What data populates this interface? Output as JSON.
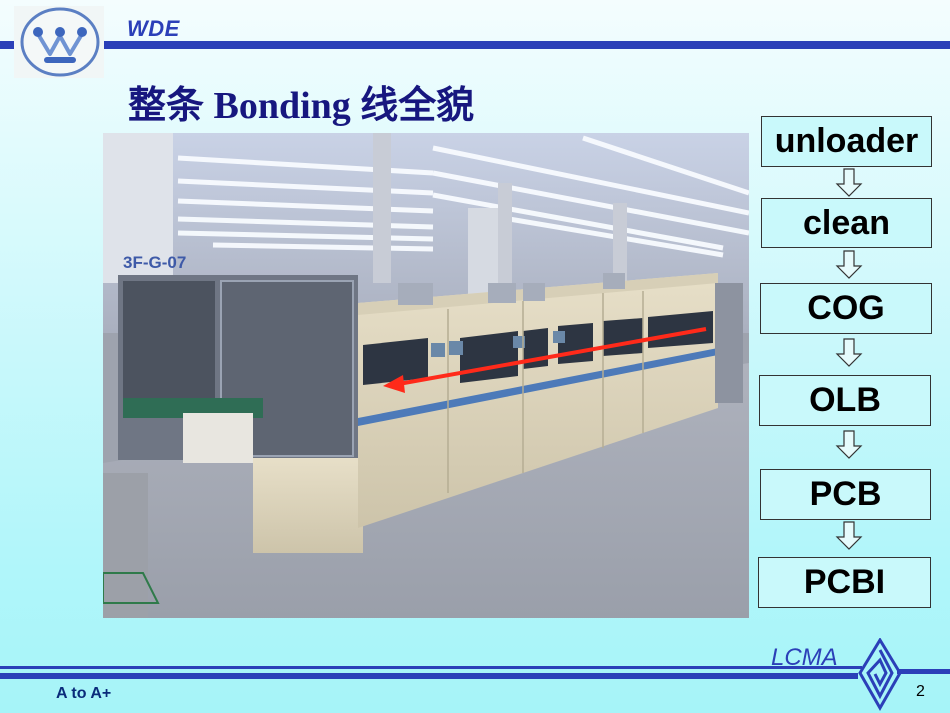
{
  "header": {
    "brand": "WDE",
    "logo": "wde-logo-icon"
  },
  "slide": {
    "title": "整条 Bonding 线全貌",
    "photo": {
      "description": "Full Bonding production line in cleanroom",
      "signage": "3F-G-07",
      "arrow_color": "#ff2a1a",
      "arrow_direction": "right-to-left"
    },
    "flow": {
      "steps": [
        {
          "label": "unloader"
        },
        {
          "label": "clean"
        },
        {
          "label": "COG"
        },
        {
          "label": "OLB"
        },
        {
          "label": "PCB"
        },
        {
          "label": "PCBI"
        }
      ],
      "arrow_icon": "down-arrow-icon"
    }
  },
  "footer": {
    "brand": "LCMA",
    "brand_icon": "lcma-spiral-diamond-icon",
    "tagline": "A to A+",
    "page_number": "2"
  },
  "colors": {
    "accent_blue": "#2b3fb8",
    "title_navy": "#17177f",
    "box_fill": "#c9f9fb"
  }
}
